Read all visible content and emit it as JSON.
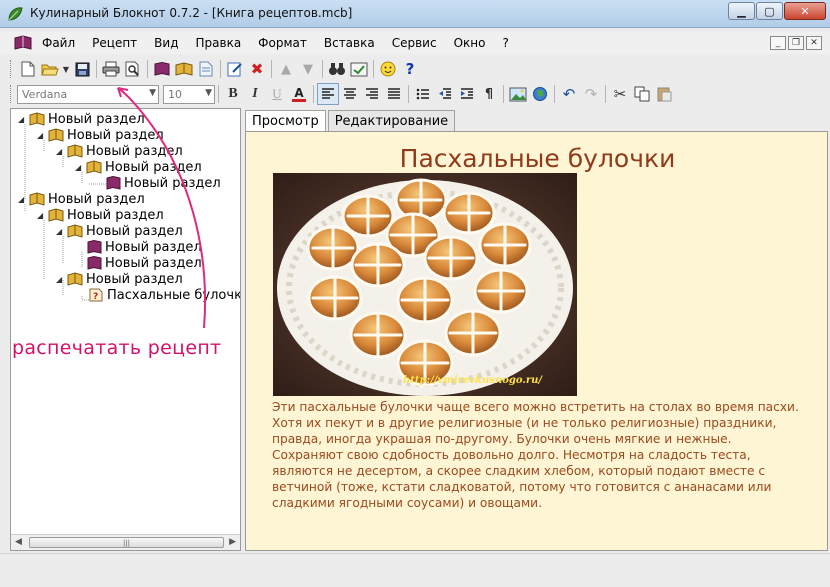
{
  "window": {
    "title": "Кулинарный Блокнот 0.7.2 - [Книга рецептов.mcb]",
    "buttons": {
      "minimize": "▁",
      "maximize": "▢",
      "close": "✕"
    }
  },
  "menu": {
    "items": [
      "Файл",
      "Рецепт",
      "Вид",
      "Правка",
      "Формат",
      "Вставка",
      "Сервис",
      "Окно",
      "?"
    ]
  },
  "toolbar": {
    "font_name": "Verdana",
    "font_size": "10",
    "bold": "B",
    "italic": "I",
    "underline": "U",
    "font_color": "A"
  },
  "tree": {
    "nodes": [
      {
        "label": "Новый раздел",
        "level": 0,
        "icon": "book-open-icon"
      },
      {
        "label": "Новый раздел",
        "level": 1,
        "icon": "book-open-icon"
      },
      {
        "label": "Новый раздел",
        "level": 2,
        "icon": "book-open-icon"
      },
      {
        "label": "Новый раздел",
        "level": 3,
        "icon": "book-open-icon"
      },
      {
        "label": "Новый раздел",
        "level": 4,
        "icon": "book-closed-icon"
      },
      {
        "label": "Новый раздел",
        "level": 0,
        "icon": "book-open-icon"
      },
      {
        "label": "Новый раздел",
        "level": 1,
        "icon": "book-open-icon"
      },
      {
        "label": "Новый раздел",
        "level": 2,
        "icon": "book-open-icon"
      },
      {
        "label": "Новый раздел",
        "level": 3,
        "icon": "book-closed-icon"
      },
      {
        "label": "Новый раздел",
        "level": 3,
        "icon": "book-closed-icon"
      },
      {
        "label": "Новый раздел",
        "level": 2,
        "icon": "book-open-icon"
      },
      {
        "label": "Пасхальные булочки",
        "level": 3,
        "icon": "recipe-page-icon"
      }
    ],
    "scroll_grip": "|||"
  },
  "annotation": "распечатать  рецепт",
  "tabs": [
    "Просмотр",
    "Редактирование"
  ],
  "recipe": {
    "title": "Пасхальные булочки",
    "watermark": "http://vmirevkusnogo.ru/",
    "text": "Эти пасхальные булочки чаще всего можно встретить на столах во время пасхи. Хотя их пекут и в другие религиозные (и не только религиозные) праздники, правда, иногда украшая по-другому. Булочки очень мягкие и нежные. Сохраняют свою сдобность довольно долго. Несмотря на сладость теста, являются не десертом, а скорее сладким хлебом, который подают вместе с ветчиной (тоже, кстати сладковатой, потому что готовится с ананасами или сладкими ягодными соусами) и овощами."
  },
  "colors": {
    "content_bg": "#fdf5d4",
    "title_color": "#8f3a1a",
    "text_color": "#9a4a1e",
    "annotation_color": "#d4116a"
  }
}
